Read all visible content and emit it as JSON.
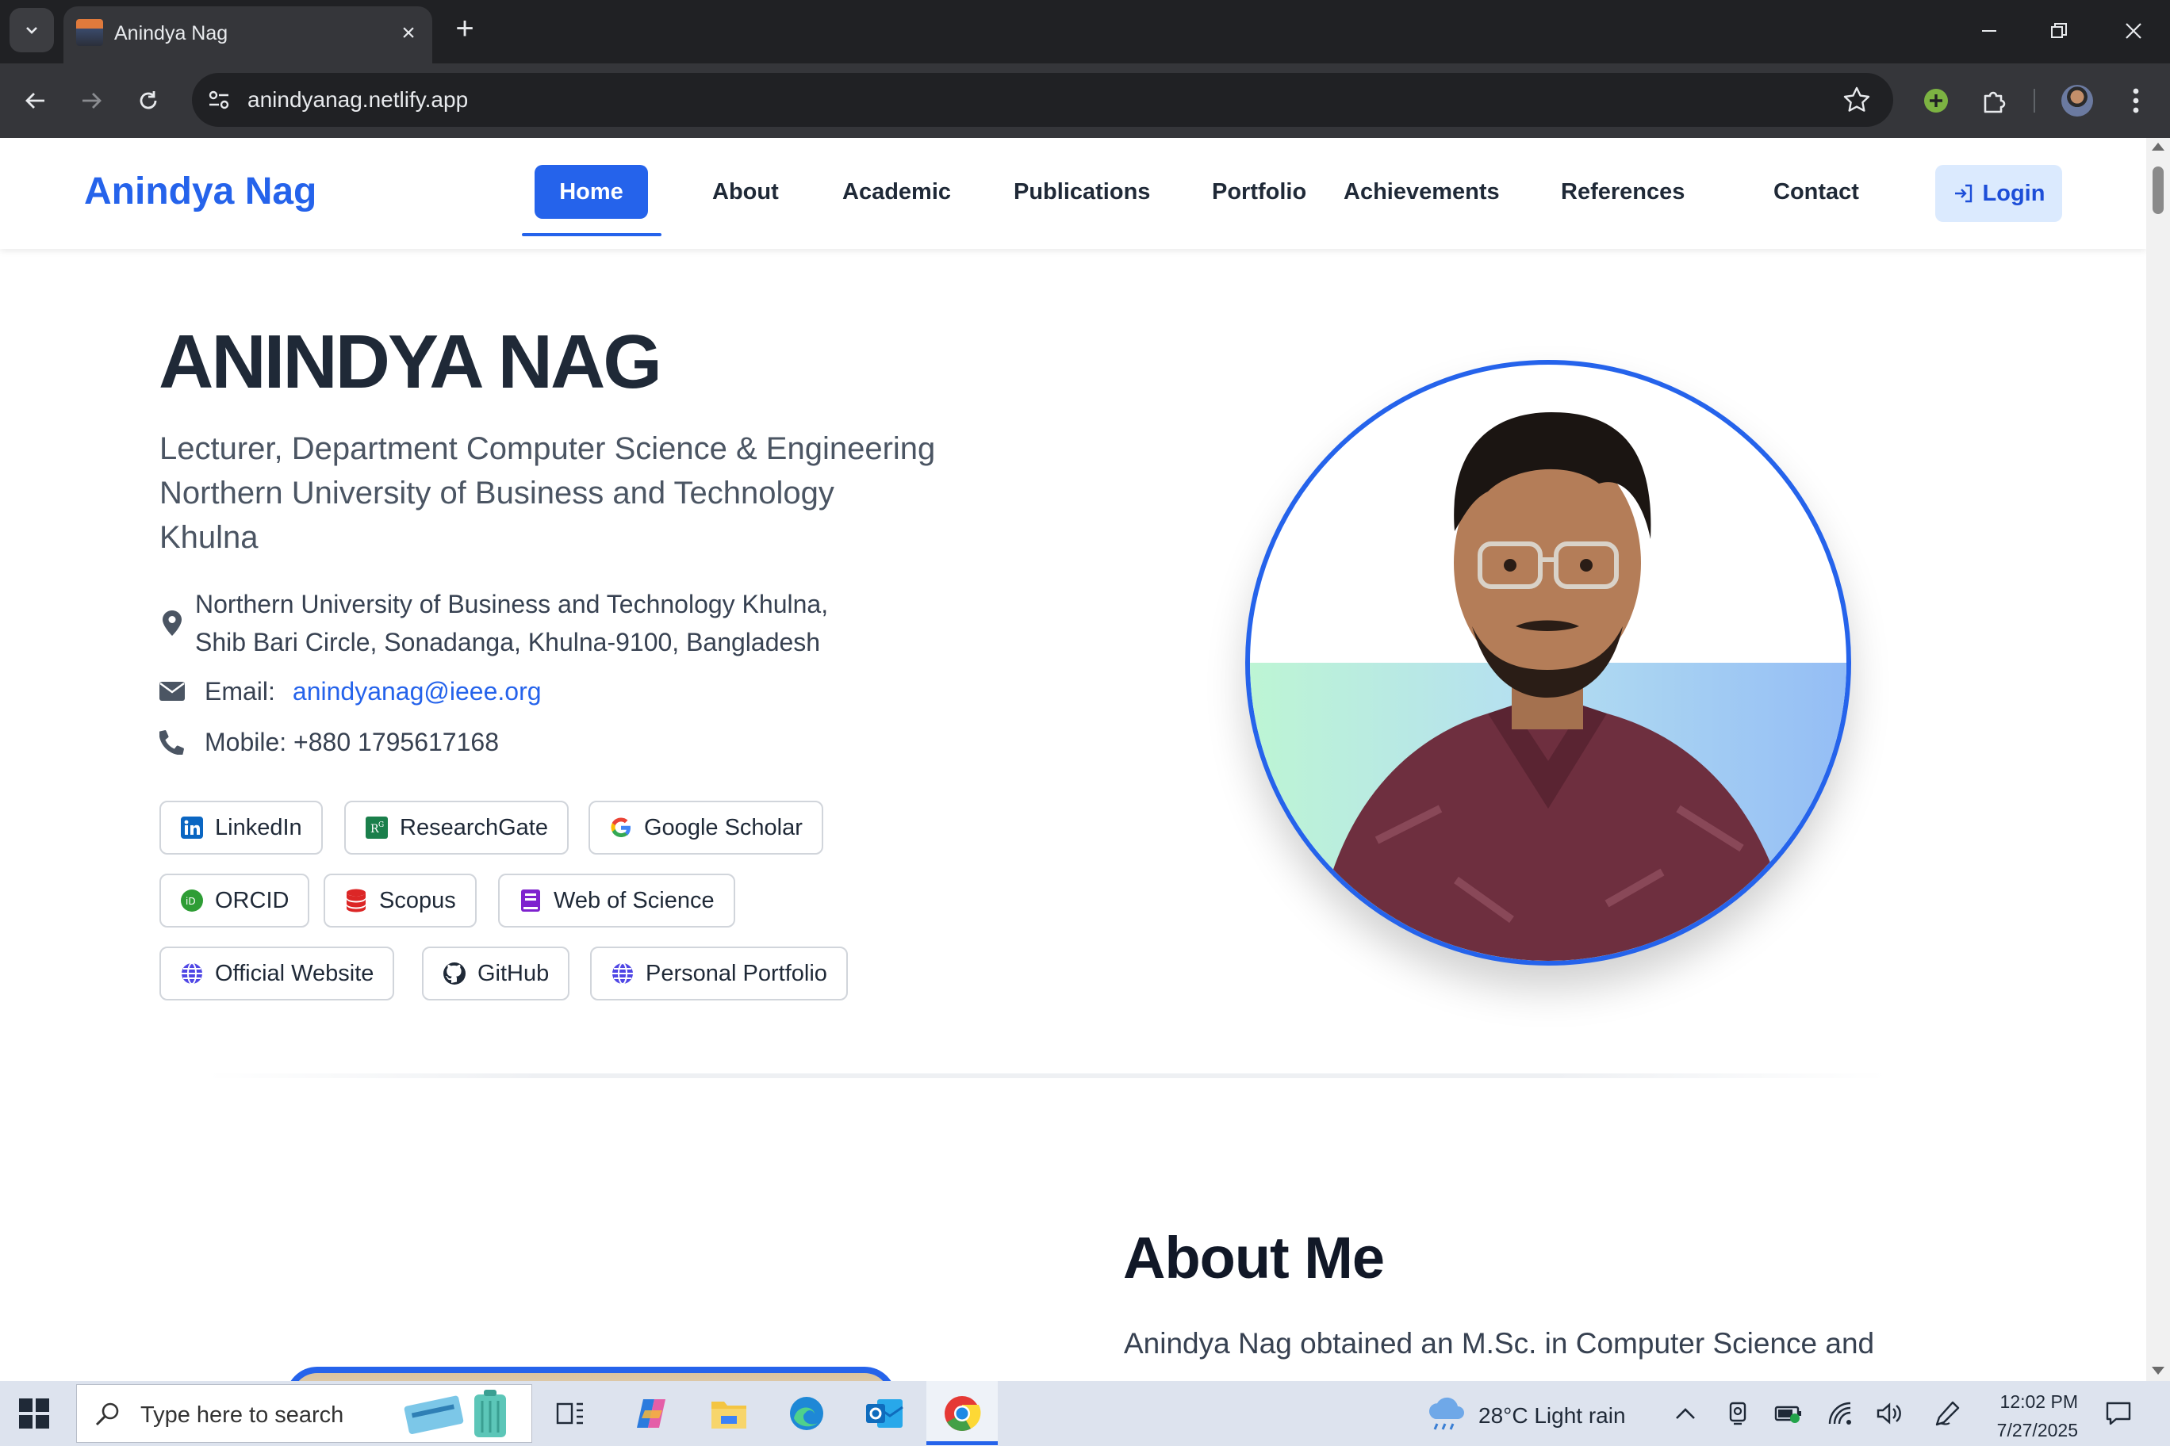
{
  "browser": {
    "tab_title": "Anindya Nag",
    "url": "anindyanag.netlify.app"
  },
  "site": {
    "brand": "Anindya Nag",
    "nav": {
      "home": "Home",
      "about": "About",
      "academic": "Academic",
      "publications": "Publications",
      "portfolio": "Portfolio",
      "achievements": "Achievements",
      "references": "References",
      "contact": "Contact",
      "login": "Login"
    }
  },
  "hero": {
    "name": "ANINDYA NAG",
    "subtitle_lines": [
      "Lecturer, Department Computer Science & Engineering",
      "Northern University of Business and Technology",
      "Khulna"
    ],
    "address_lines": [
      "Northern University of Business and Technology Khulna,",
      "Shib Bari Circle, Sonadanga, Khulna-9100, Bangladesh"
    ],
    "email_label": "Email:",
    "email": "anindyanag@ieee.org",
    "mobile": "Mobile: +880 1795617168",
    "links": {
      "linkedin": "LinkedIn",
      "researchgate": "ResearchGate",
      "scholar": "Google Scholar",
      "orcid": "ORCID",
      "scopus": "Scopus",
      "wos": "Web of Science",
      "website": "Official Website",
      "github": "GitHub",
      "portfolio": "Personal Portfolio"
    }
  },
  "about": {
    "title": "About Me",
    "text": "Anindya Nag obtained an M.Sc. in Computer Science and"
  },
  "taskbar": {
    "search_placeholder": "Type here to search",
    "weather": "28°C  Light rain",
    "time": "12:02 PM",
    "date": "7/27/2025"
  },
  "colors": {
    "accent": "#2563eb",
    "chrome_dark": "#202124",
    "chrome_toolbar": "#35363a"
  }
}
